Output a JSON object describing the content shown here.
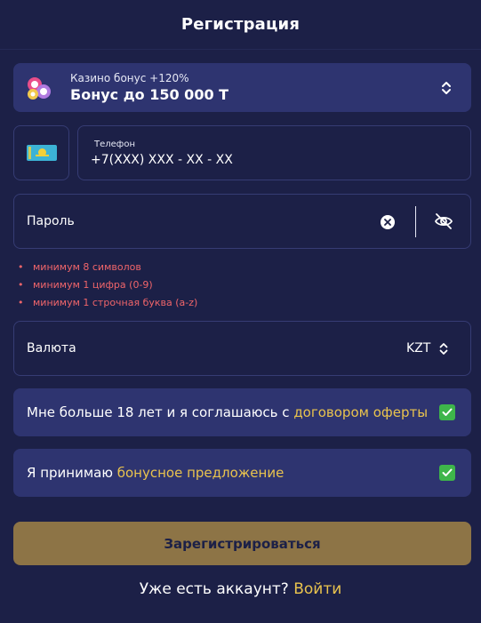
{
  "header": {
    "title": "Регистрация"
  },
  "bonus": {
    "icon": "casino-chips-icon",
    "subtitle": "Казино бонус +120%",
    "title": "Бонус до 150 000 Т"
  },
  "phone": {
    "country_flag": "kazakhstan-flag-icon",
    "label": "Телефон",
    "placeholder": "+7(XXX) XXX - XX - XX"
  },
  "password": {
    "placeholder": "Пароль"
  },
  "password_rules": [
    "минимум 8 символов",
    "минимум 1 цифра (0-9)",
    "минимум 1 строчная буква (a-z)"
  ],
  "currency": {
    "label": "Валюта",
    "value": "KZT"
  },
  "agreements": {
    "age": {
      "text": "Мне больше 18 лет и я соглашаюсь с ",
      "link": "договором оферты",
      "checked": true
    },
    "bonus": {
      "text": "Я принимаю ",
      "link": "бонусное предложение",
      "checked": true
    }
  },
  "submit_label": "Зарегистрироваться",
  "login": {
    "text": "Уже есть аккаунт? ",
    "link": "Войти"
  },
  "colors": {
    "background": "#1c2047",
    "card": "#2e3470",
    "border": "#363c74",
    "accent_link": "#e9c34e",
    "error": "#f0656a",
    "checkbox": "#3eb54a",
    "button": "#8d7446"
  }
}
